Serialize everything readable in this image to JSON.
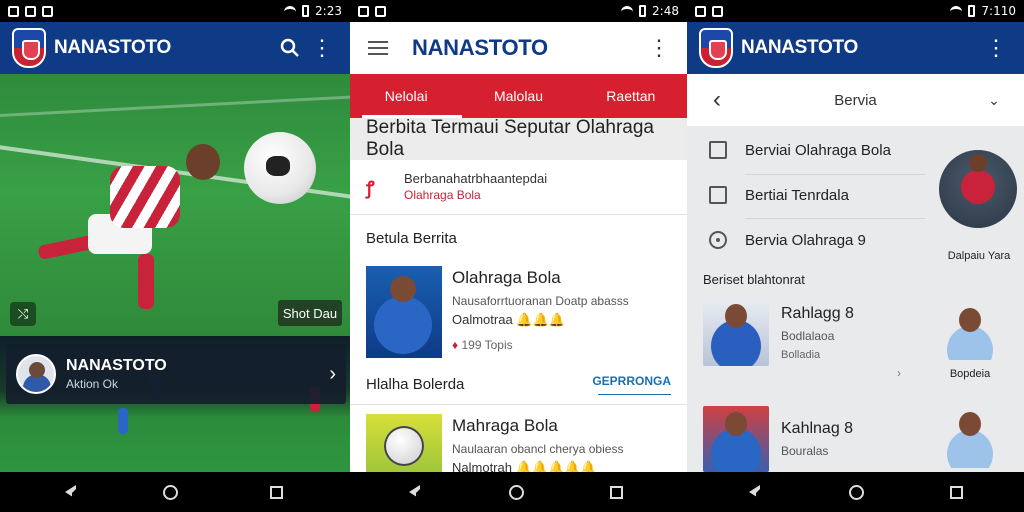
{
  "status_bars": [
    {
      "time": "2:23"
    },
    {
      "time": "2:48"
    },
    {
      "time": "7:110"
    }
  ],
  "screen1": {
    "brand": "NANASTOTO",
    "hero_badge": "Shot Dau",
    "card": {
      "title": "NANASTOTO",
      "subtitle": "Aktion Ok"
    }
  },
  "screen2": {
    "brand": "NANASTOTO",
    "tabs": [
      {
        "label": "Nelolai"
      },
      {
        "label": "Malolau"
      },
      {
        "label": "Raettan"
      }
    ],
    "section_title": "Berbita Termaui Seputar Olahraga Bola",
    "feature": {
      "line1": "Berbanahatrbhaantepdai",
      "line2": "Olahraga Bola"
    },
    "latest_label": "Betula Berrita",
    "news": [
      {
        "title": "Olahraga Bola",
        "desc": "Nausaforrtuoranan Doatp abasss",
        "meta": "Oalmotraa 🔔🔔🔔",
        "footer": "199 Topis"
      },
      {
        "title": "Mahraga Bola",
        "desc": "Naulaaran obancl cherya obiess",
        "meta": "Nalmotrah 🔔🔔🔔🔔🔔",
        "footer": ""
      }
    ],
    "popular_label": "Hlalha Bolerda",
    "see_all": "GEPRRONGA"
  },
  "screen3": {
    "brand": "NANASTOTO",
    "sub_title": "Bervia",
    "filters": [
      {
        "label": "Berviai Olahraga Bola",
        "type": "checkbox"
      },
      {
        "label": "Bertiai Tenrdala",
        "type": "checkbox"
      },
      {
        "label": "Bervia Olahraga 9",
        "type": "radio"
      }
    ],
    "featured_caption": "Dalpaiu Yara",
    "list_label": "Beriset blahtonrat",
    "players": [
      {
        "name": "Rahlagg 8",
        "line1": "Bodlalaoa",
        "line2": "Bolladia"
      },
      {
        "name": "Kahlnag 8",
        "line1": "Bouralas",
        "line2": ""
      }
    ],
    "side_captions": [
      "Bopdeia",
      ""
    ]
  },
  "nav": {
    "icons": [
      "back-icon",
      "home-icon",
      "recents-icon"
    ]
  },
  "colors": {
    "primary_blue": "#0e3a86",
    "accent_red": "#d6202f"
  }
}
